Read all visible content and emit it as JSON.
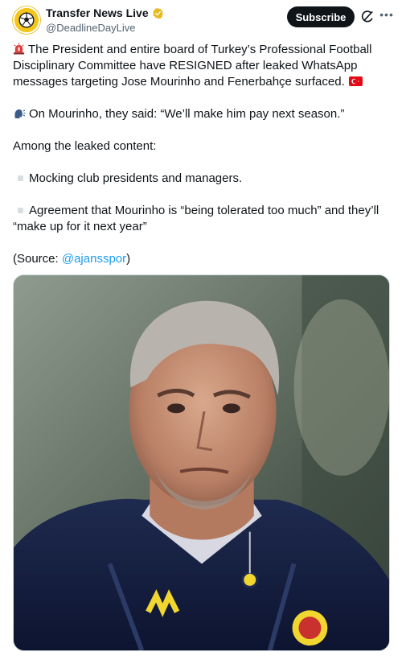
{
  "header": {
    "display_name": "Transfer News Live",
    "handle": "@DeadlineDayLive",
    "subscribe_label": "Subscribe",
    "avatar_icon": "soccer-ball-icon",
    "verified_icon": "verified-badge-icon",
    "more_icon": "more-options-icon",
    "grok_icon": "grok-icon"
  },
  "tweet": {
    "para1_text": "The President and entire board of Turkey’s Professional Football Disciplinary Committee have RESIGNED after leaked WhatsApp messages targeting Jose Mourinho and Fenerbahçe surfaced.",
    "para2_text": "On Mourinho, they said: “We’ll make him pay next season.”",
    "para3_text": "Among the leaked content:",
    "bullet1_text": "Mocking club presidents and managers.",
    "bullet2_text": "Agreement that Mourinho is “being tolerated too much” and they’ll “make up for it next year”",
    "source_prefix": "(Source: ",
    "source_mention": "@ajansspor",
    "source_suffix": ")"
  },
  "colors": {
    "accent": "#1d9bf0",
    "subscribe_bg": "#0f1419",
    "avatar_bg": "#f4c619",
    "verified": "#e8b923",
    "text_secondary": "#536471"
  }
}
